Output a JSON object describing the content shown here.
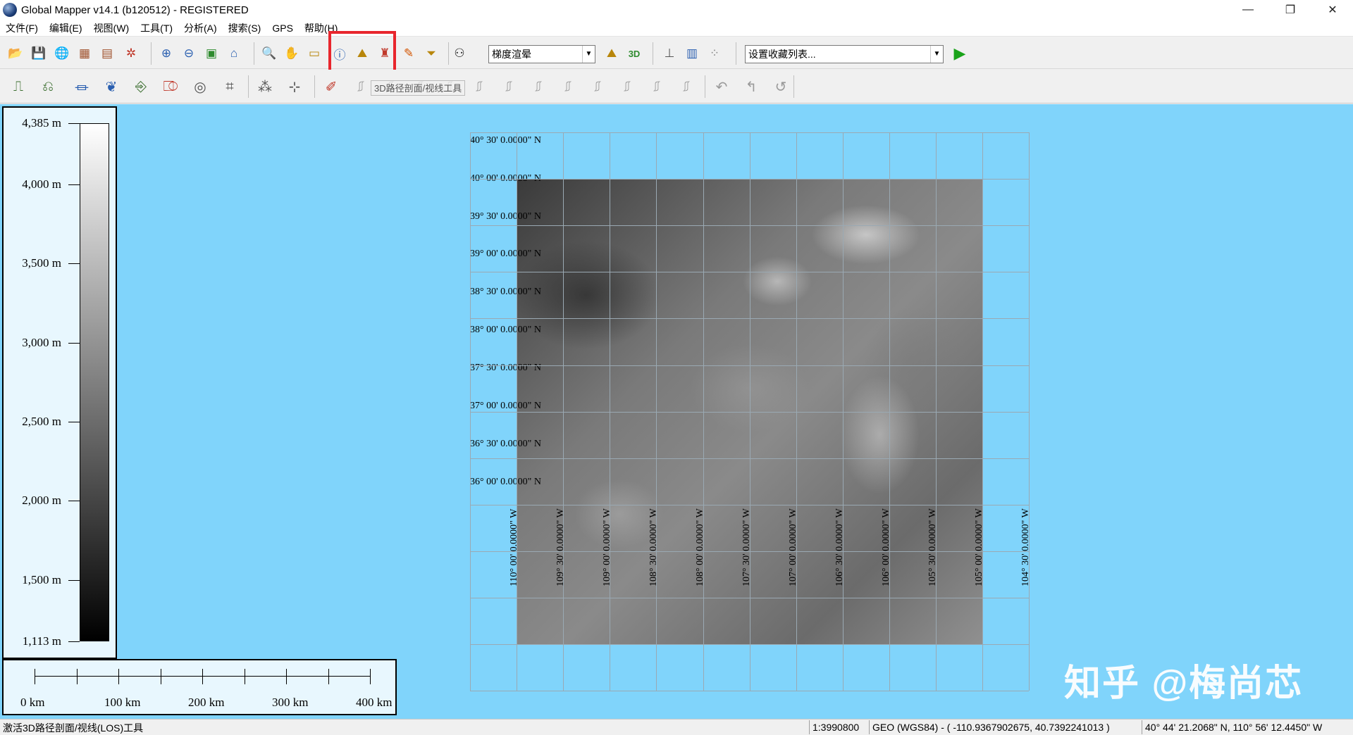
{
  "window": {
    "title": "Global Mapper v14.1 (b120512) - REGISTERED",
    "min_glyph": "—",
    "max_glyph": "❐",
    "close_glyph": "✕"
  },
  "menu": [
    "文件(F)",
    "编辑(E)",
    "视图(W)",
    "工具(T)",
    "分析(A)",
    "搜索(S)",
    "GPS",
    "帮助(H)"
  ],
  "toolbar": {
    "render_mode": "梯度渲晕",
    "favorites": "设置收藏列表...",
    "tooltip": "3D路径剖面/视线工具",
    "icons": [
      "open-folder-icon",
      "save-icon",
      "globe-icon",
      "catalog-icon",
      "export-icon",
      "config-icon",
      "zoom-in-icon",
      "zoom-out-icon",
      "full-view-icon",
      "home-icon",
      "zoom-tool-icon",
      "pan-icon",
      "measure-icon",
      "feature-info-icon",
      "path-profile-icon",
      "tower-icon",
      "digitizer-icon",
      "filter-icon",
      "binoculars-icon",
      "3d-view-icon",
      "3d-text-icon",
      "gps-track-icon",
      "overlay-control-icon",
      "points-icon"
    ]
  },
  "legend": {
    "labels": [
      "4,385 m",
      "4,000 m",
      "3,500 m",
      "3,000 m",
      "2,500 m",
      "2,000 m",
      "1,500 m",
      "1,113 m"
    ],
    "max": 4385,
    "min": 1113,
    "values": [
      4385,
      4000,
      3500,
      3000,
      2500,
      2000,
      1500,
      1113
    ]
  },
  "scale": {
    "labels": [
      "0 km",
      "100 km",
      "200 km",
      "300 km",
      "400 km"
    ],
    "max_km": 400,
    "values_km": [
      0,
      100,
      200,
      300,
      400
    ],
    "tick_count": 9
  },
  "map": {
    "lat_labels": [
      "40° 30' 0.0000\" N",
      "40° 00' 0.0000\" N",
      "39° 30' 0.0000\" N",
      "39° 00' 0.0000\" N",
      "38° 30' 0.0000\" N",
      "38° 00' 0.0000\" N",
      "37° 30' 0.0000\" N",
      "37° 00' 0.0000\" N",
      "36° 30' 0.0000\" N",
      "36° 00' 0.0000\" N"
    ],
    "lon_labels": [
      "110° 00' 0.0000\" W",
      "109° 30' 0.0000\" W",
      "109° 00' 0.0000\" W",
      "108° 30' 0.0000\" W",
      "108° 00' 0.0000\" W",
      "107° 30' 0.0000\" W",
      "107° 00' 0.0000\" W",
      "106° 30' 0.0000\" W",
      "106° 00' 0.0000\" W",
      "105° 30' 0.0000\" W",
      "105° 00' 0.0000\" W",
      "104° 30' 0.0000\" W"
    ]
  },
  "watermark": "知乎 @梅尚芯",
  "status": {
    "message": "激活3D路径剖面/视线(LOS)工具",
    "scale": "1:3990800",
    "projection": "GEO (WGS84) - ( -110.9367902675, 40.7392241013 )",
    "cursor": "40° 44' 21.2068\" N, 110° 56' 12.4450\" W"
  },
  "colors": {
    "map_background": "#80d4fb",
    "highlight": "#e8262d",
    "go_arrow": "#1aa31a"
  }
}
